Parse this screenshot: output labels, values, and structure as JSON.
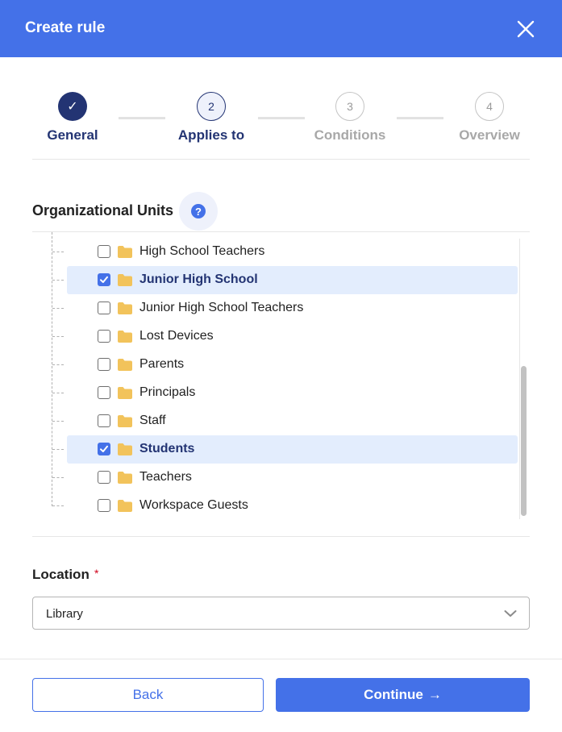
{
  "dialog": {
    "title": "Create rule"
  },
  "stepper": {
    "steps": [
      {
        "number": "✓",
        "label": "General",
        "state": "done"
      },
      {
        "number": "2",
        "label": "Applies to",
        "state": "active"
      },
      {
        "number": "3",
        "label": "Conditions",
        "state": "todo"
      },
      {
        "number": "4",
        "label": "Overview",
        "state": "todo"
      }
    ]
  },
  "org_units": {
    "title": "Organizational Units",
    "help_glyph": "?",
    "items": [
      {
        "label": "High School Teachers",
        "checked": false
      },
      {
        "label": "Junior High School",
        "checked": true
      },
      {
        "label": "Junior High School Teachers",
        "checked": false
      },
      {
        "label": "Lost Devices",
        "checked": false
      },
      {
        "label": "Parents",
        "checked": false
      },
      {
        "label": "Principals",
        "checked": false
      },
      {
        "label": "Staff",
        "checked": false
      },
      {
        "label": "Students",
        "checked": true
      },
      {
        "label": "Teachers",
        "checked": false
      },
      {
        "label": "Workspace Guests",
        "checked": false
      }
    ]
  },
  "location": {
    "label": "Location",
    "required_mark": "*",
    "selected": "Library"
  },
  "footer": {
    "back_label": "Back",
    "continue_label": "Continue",
    "continue_arrow": "→"
  },
  "colors": {
    "primary": "#4471e8",
    "navy": "#233473",
    "selection": "#e3edfd",
    "folder": "#f2c35b"
  }
}
